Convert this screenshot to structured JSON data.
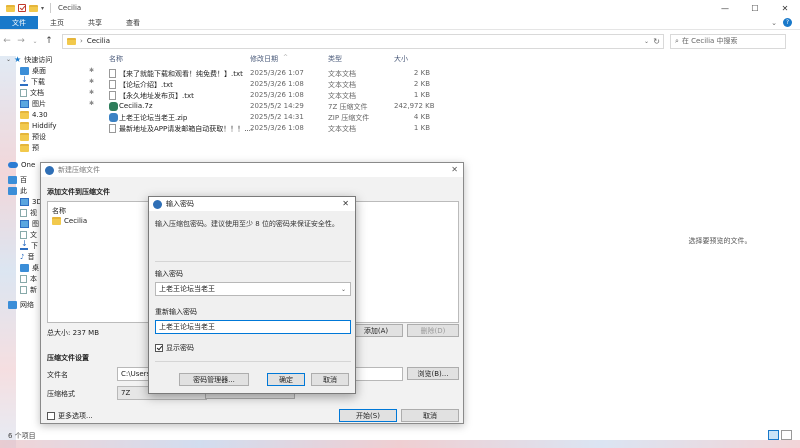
{
  "window": {
    "title": "Cecilia"
  },
  "ribbon": {
    "tabs": [
      "文件",
      "主页",
      "共享",
      "查看"
    ]
  },
  "address": {
    "path": "Cecilia",
    "search_placeholder": "在 Cecilia 中搜索"
  },
  "nav": {
    "quick_access": "快速访问",
    "items": [
      "桌面",
      "下载",
      "文档",
      "图片",
      "4.30",
      "Hiddify",
      "预设",
      "预"
    ],
    "onedrive": "One",
    "this_pc_trunc": [
      "百",
      "此",
      "3D",
      "视",
      "图",
      "文",
      "下",
      "音",
      "桌",
      "本",
      "新"
    ],
    "network": "网络"
  },
  "columns": {
    "name": "名称",
    "date": "修改日期",
    "type": "类型",
    "size": "大小"
  },
  "files": [
    {
      "name": "【来了就能下载和观看！纯免费！】.txt",
      "date": "2025/3/26 1:07",
      "type": "文本文档",
      "size": "2 KB",
      "icon": "txt"
    },
    {
      "name": "【论坛介绍】.txt",
      "date": "2025/3/26 1:08",
      "type": "文本文档",
      "size": "2 KB",
      "icon": "txt"
    },
    {
      "name": "【永久地址发布页】.txt",
      "date": "2025/3/26 1:08",
      "type": "文本文档",
      "size": "1 KB",
      "icon": "txt"
    },
    {
      "name": "Cecilia.7z",
      "date": "2025/5/2 14:29",
      "type": "7Z 压缩文件",
      "size": "242,972 KB",
      "icon": "7z"
    },
    {
      "name": "上老王论坛当老王.zip",
      "date": "2025/5/2 14:31",
      "type": "ZIP 压缩文件",
      "size": "4 KB",
      "icon": "zip"
    },
    {
      "name": "最新地址及APP请发邮箱自动获取！！！....",
      "date": "2025/3/26 1:08",
      "type": "文本文档",
      "size": "1 KB",
      "icon": "txt"
    }
  ],
  "preview_text": "选择要预览的文件。",
  "status": {
    "count": "6 个项目"
  },
  "archive_dialog": {
    "title": "新建压缩文件",
    "heading": "添加文件到压缩文件",
    "col_name": "名称",
    "item": "Cecilia",
    "total": "总大小: 237 MB",
    "add_button": "添加(A)",
    "delete_button": "删除(D)",
    "settings_heading": "压缩文件设置",
    "file_label": "文件名",
    "file_value": "C:\\Users\\",
    "browse_button": "浏览(B)...",
    "format_label": "压缩格式",
    "format_value": "7Z",
    "more_label": "更多选项...",
    "start_button": "开始(S)",
    "cancel_button": "取消"
  },
  "password_dialog": {
    "title": "输入密码",
    "description": "输入压缩包密码。建议使用至少 8 位的密码来保证安全性。",
    "enter_label": "输入密码",
    "enter_value": "上老王论坛当老王",
    "reenter_label": "重新输入密码",
    "reenter_value": "上老王论坛当老王",
    "show_password": "显示密码",
    "show_checked": true,
    "manager_button": "密码管理器...",
    "ok_button": "确定",
    "cancel_button": "取消"
  },
  "colors": {
    "accent": "#1979ca",
    "focus": "#0078d7",
    "folder": "#f2c94c"
  }
}
